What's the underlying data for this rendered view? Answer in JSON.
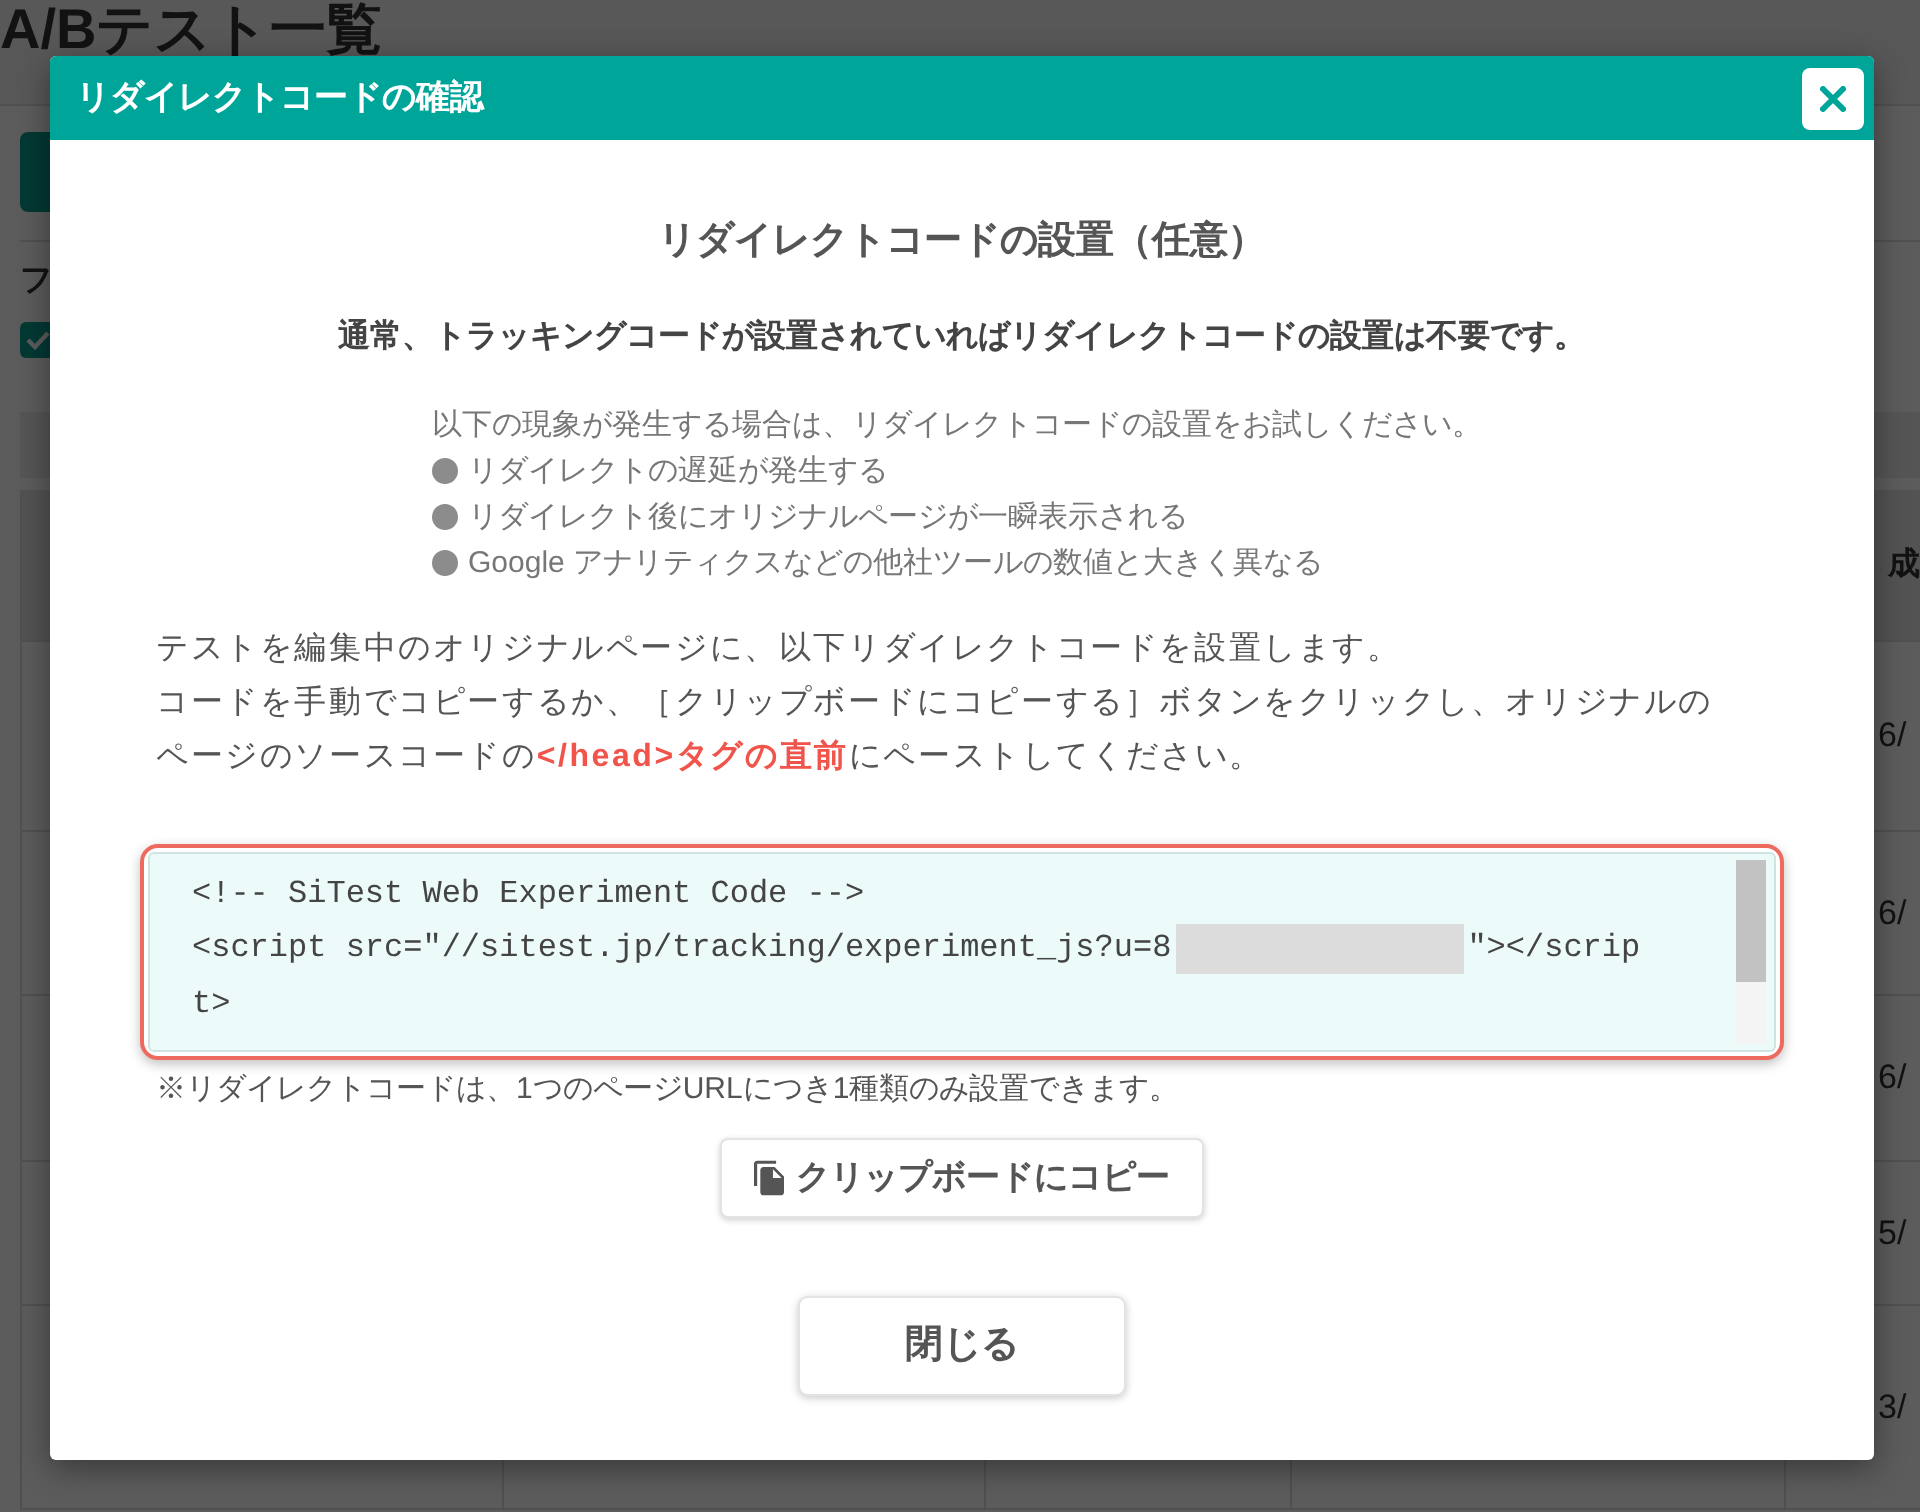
{
  "background_page": {
    "title": "A/Bテスト一覧",
    "label_fragment": "フ",
    "filter_checkbox": {
      "checked": true
    },
    "table": {
      "header_fragment": "成",
      "rows": [
        {
          "column_5": "6/"
        },
        {
          "column_5": "6/"
        },
        {
          "column_5": "6/"
        },
        {
          "column_5": "5/"
        },
        {
          "column_5": "3/"
        }
      ]
    }
  },
  "dialog": {
    "title": "リダイレクトコードの確認",
    "heading": "リダイレクトコードの設置（任意）",
    "lead": "通常、トラッキングコードが設置されていればリダイレクトコードの設置は不要です。",
    "notice": {
      "intro": "以下の現象が発生する場合は、リダイレクトコードの設置をお試しください。",
      "items": [
        "リダイレクトの遅延が発生する",
        "リダイレクト後にオリジナルページが一瞬表示される",
        "Google アナリティクスなどの他社ツールの数値と大きく異なる"
      ]
    },
    "instructions": [
      "テストを編集中のオリジナルページに、以下リダイレクトコードを設置します。",
      "コードを手動でコピーするか、［クリップボードにコピーする］ボタンをクリックし、オリジナルのページのソースコードの**</head>タグの直前**にペーストしてください。"
    ],
    "code_block": {
      "lines": [
        [
          {
            "kind": "text",
            "text": "<!-- SiTest Web Experiment Code -->"
          }
        ],
        [
          {
            "kind": "text",
            "text": "<script src=\"//sitest.jp/tracking/experiment_js?u=8"
          },
          {
            "kind": "redacted"
          },
          {
            "kind": "text",
            "text": "\"></scrip"
          }
        ],
        [
          {
            "kind": "text",
            "text": "t>"
          }
        ]
      ]
    },
    "footnote": "※リダイレクトコードは、1つのページURLにつき1種類のみ設置できます。",
    "copy_button": {
      "label": "クリップボードにコピー"
    },
    "close_button": {
      "label": "閉じる"
    }
  }
}
